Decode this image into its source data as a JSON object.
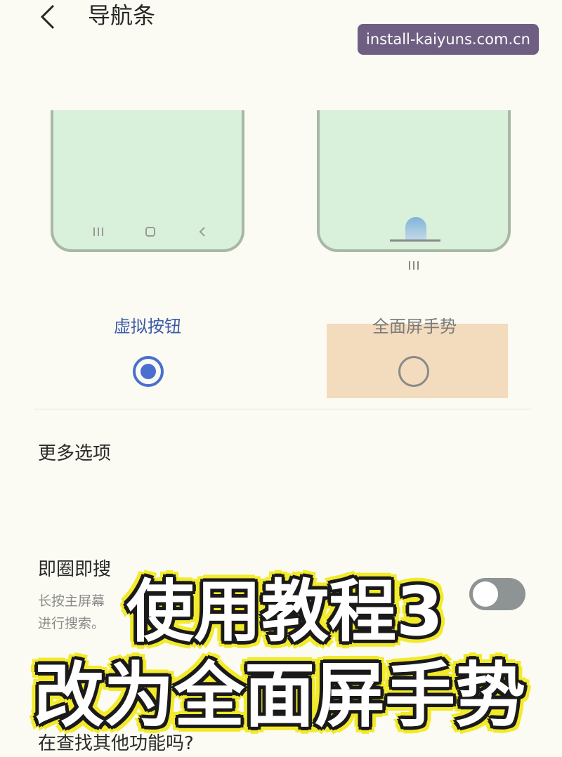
{
  "header": {
    "title": "导航条",
    "back_icon": "chevron-left-icon"
  },
  "watermark": "install-kaiyuns.com.cn",
  "previews": {
    "virtual_buttons_icons": [
      "recent-apps-icon",
      "home-icon",
      "back-icon"
    ],
    "gesture_icons": [
      "gesture-handle-icon",
      "gesture-line-icon",
      "recent-apps-icon"
    ]
  },
  "options": {
    "virtual_label": "虚拟按钮",
    "gesture_label": "全面屏手势",
    "selected": "virtual",
    "accent_color": "#4a6fd0"
  },
  "more_options": "更多选项",
  "circle_search": {
    "title": "即圈即搜",
    "desc_line1": "长按主屏幕",
    "desc_line2": "进行搜索。",
    "toggle_state": "off"
  },
  "footer_question": "在查找其他功能吗?",
  "caption": {
    "line1": "使用教程3",
    "line2": "改为全面屏手势"
  }
}
